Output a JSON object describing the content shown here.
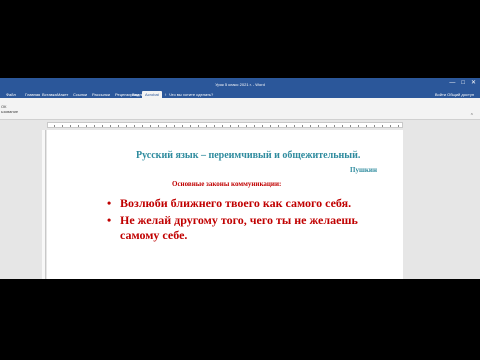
{
  "window": {
    "title": "Урок 5 класс 2021 г. - Word",
    "controls": [
      "—",
      "□",
      "✕"
    ]
  },
  "tabs": [
    {
      "label": "Файл"
    },
    {
      "label": "Главная"
    },
    {
      "label": "Вставка"
    },
    {
      "label": "Макет"
    },
    {
      "label": "Ссылки"
    },
    {
      "label": "Рассылки"
    },
    {
      "label": "Рецензирование"
    },
    {
      "label": "Вид"
    },
    {
      "label": "Acrobat"
    }
  ],
  "tell_me": {
    "text": "Что вы хотите сделать?"
  },
  "tabs_right": {
    "text": "Войти  Общий доступ"
  },
  "ribbon": {
    "left_lines": [
      "ОК",
      "ьзование"
    ],
    "collapse_symbol": "⌃"
  },
  "document": {
    "title": "Русский язык – переимчивый и общежительный.",
    "author": "Пушкин",
    "heading": "Основные законы коммуникации:",
    "rules": [
      {
        "bullet": "•",
        "text": "Возлюби ближнего твоего как самого себя."
      },
      {
        "bullet": "•",
        "text": "Не желай другому того, чего ты не желаешь самому себе."
      }
    ]
  },
  "colors": {
    "word_blue": "#2b579a",
    "title_teal": "#2e8b9e",
    "rule_red": "#c00000"
  }
}
